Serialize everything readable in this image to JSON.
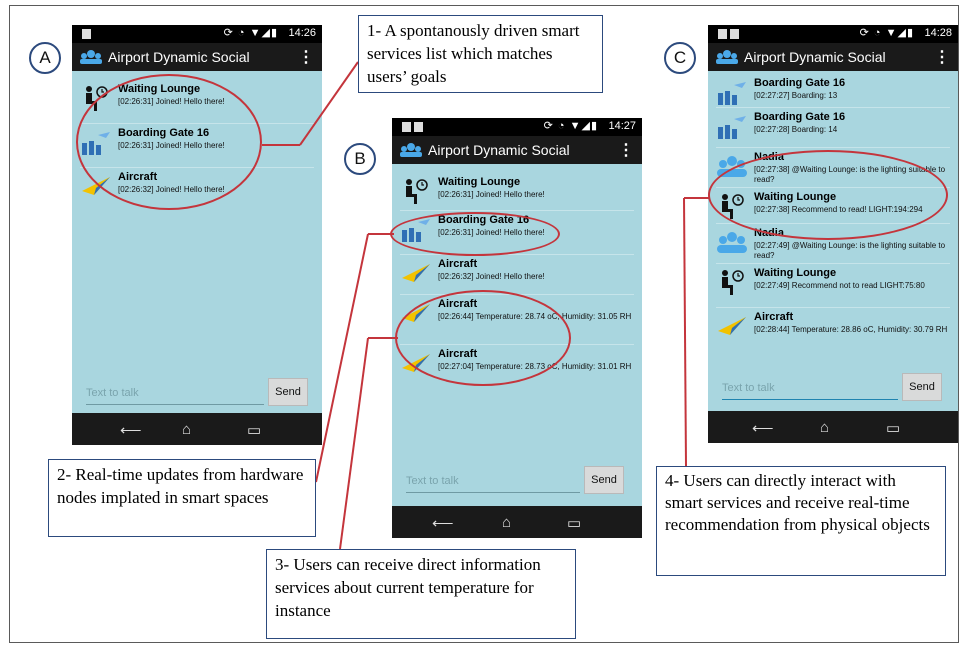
{
  "app_title": "Airport Dynamic Social",
  "text_placeholder": "Text to talk",
  "send_label": "Send",
  "labels": {
    "a": "A",
    "b": "B",
    "c": "C"
  },
  "phone_a": {
    "time": "14:26",
    "items": [
      {
        "title": "Waiting Lounge",
        "msg": "[02:26:31] Joined! Hello there!",
        "icon": "waiting-lounge-icon"
      },
      {
        "title": "Boarding Gate 16",
        "msg": "[02:26:31] Joined! Hello there!",
        "icon": "boarding-gate-icon"
      },
      {
        "title": "Aircraft",
        "msg": "[02:26:32] Joined! Hello there!",
        "icon": "aircraft-icon"
      }
    ]
  },
  "phone_b": {
    "time": "14:27",
    "items": [
      {
        "title": "Waiting Lounge",
        "msg": "[02:26:31] Joined! Hello there!",
        "icon": "waiting-lounge-icon"
      },
      {
        "title": "Boarding Gate 16",
        "msg": "[02:26:31] Joined! Hello there!",
        "icon": "boarding-gate-icon"
      },
      {
        "title": "Aircraft",
        "msg": "[02:26:32] Joined! Hello there!",
        "icon": "aircraft-icon"
      },
      {
        "title": "Aircraft",
        "msg": "[02:26:44] Temperature: 28.74 oC, Humidity: 31.05 RH",
        "icon": "aircraft-icon"
      },
      {
        "title": "Aircraft",
        "msg": "[02:27:04] Temperature: 28.73 oC, Humidity: 31.01 RH",
        "icon": "aircraft-icon"
      }
    ]
  },
  "phone_c": {
    "time": "14:28",
    "items": [
      {
        "title": "Boarding Gate 16",
        "msg": "[02:27:27] Boarding: 13",
        "icon": "boarding-gate-icon"
      },
      {
        "title": "Boarding Gate 16",
        "msg": "[02:27:28] Boarding: 14",
        "icon": "boarding-gate-icon"
      },
      {
        "title": "Nadia",
        "msg": "[02:27:38] @Waiting Lounge: is the lighting suitable to read?",
        "icon": "people-icon"
      },
      {
        "title": "Waiting Lounge",
        "msg": "[02:27:38] Recommend to read! LIGHT:194:294",
        "icon": "waiting-lounge-icon"
      },
      {
        "title": "Nadia",
        "msg": "[02:27:49] @Waiting Lounge: is the lighting suitable to read?",
        "icon": "people-icon"
      },
      {
        "title": "Waiting Lounge",
        "msg": "[02:27:49] Recommend not to read LIGHT:75:80",
        "icon": "waiting-lounge-icon"
      },
      {
        "title": "Aircraft",
        "msg": "[02:28:44] Temperature: 28.86 oC, Humidity: 30.79 RH",
        "icon": "aircraft-icon"
      }
    ]
  },
  "callouts": {
    "c1": "1- A spontanously driven smart services list which matches users’ goals",
    "c2": "2- Real-time updates from hardware nodes implated in smart spaces",
    "c3": "3- Users can receive direct information services about current temperature for instance",
    "c4": "4- Users can directly interact with smart services and receive real-time recommendation from physical objects"
  },
  "colors": {
    "screen": "#a9d6df",
    "bar": "#1a1a1a",
    "ellipse": "#c4353c",
    "callout_border": "#2c4a7d"
  }
}
